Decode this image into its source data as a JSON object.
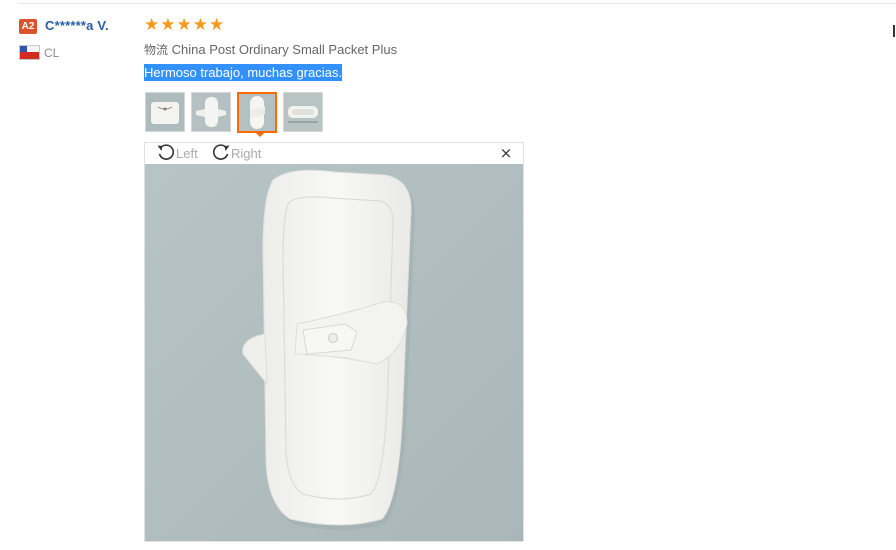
{
  "review": {
    "level_badge": "A2",
    "username": "C******a V.",
    "country": "CL",
    "rating": 5,
    "stars": [
      "★",
      "★",
      "★",
      "★",
      "★"
    ],
    "shipping_prefix": "物流",
    "shipping_method": "China Post Ordinary Small Packet Plus",
    "feedback_text": "Hermoso trabajo, muchas gracias."
  },
  "thumbnails": [
    {
      "alt": "pad-folded-photo"
    },
    {
      "alt": "pad-open-photo"
    },
    {
      "alt": "pad-closeup-photo",
      "selected": true
    },
    {
      "alt": "pad-side-photo"
    }
  ],
  "viewer": {
    "rotate_left_label": "Left",
    "rotate_right_label": "Right",
    "close_symbol": "×"
  },
  "colors": {
    "accent": "#ff6a00",
    "star": "#f59a1c",
    "username": "#2a5fa5",
    "badge": "#d9532c",
    "selection": "#3391ff"
  }
}
